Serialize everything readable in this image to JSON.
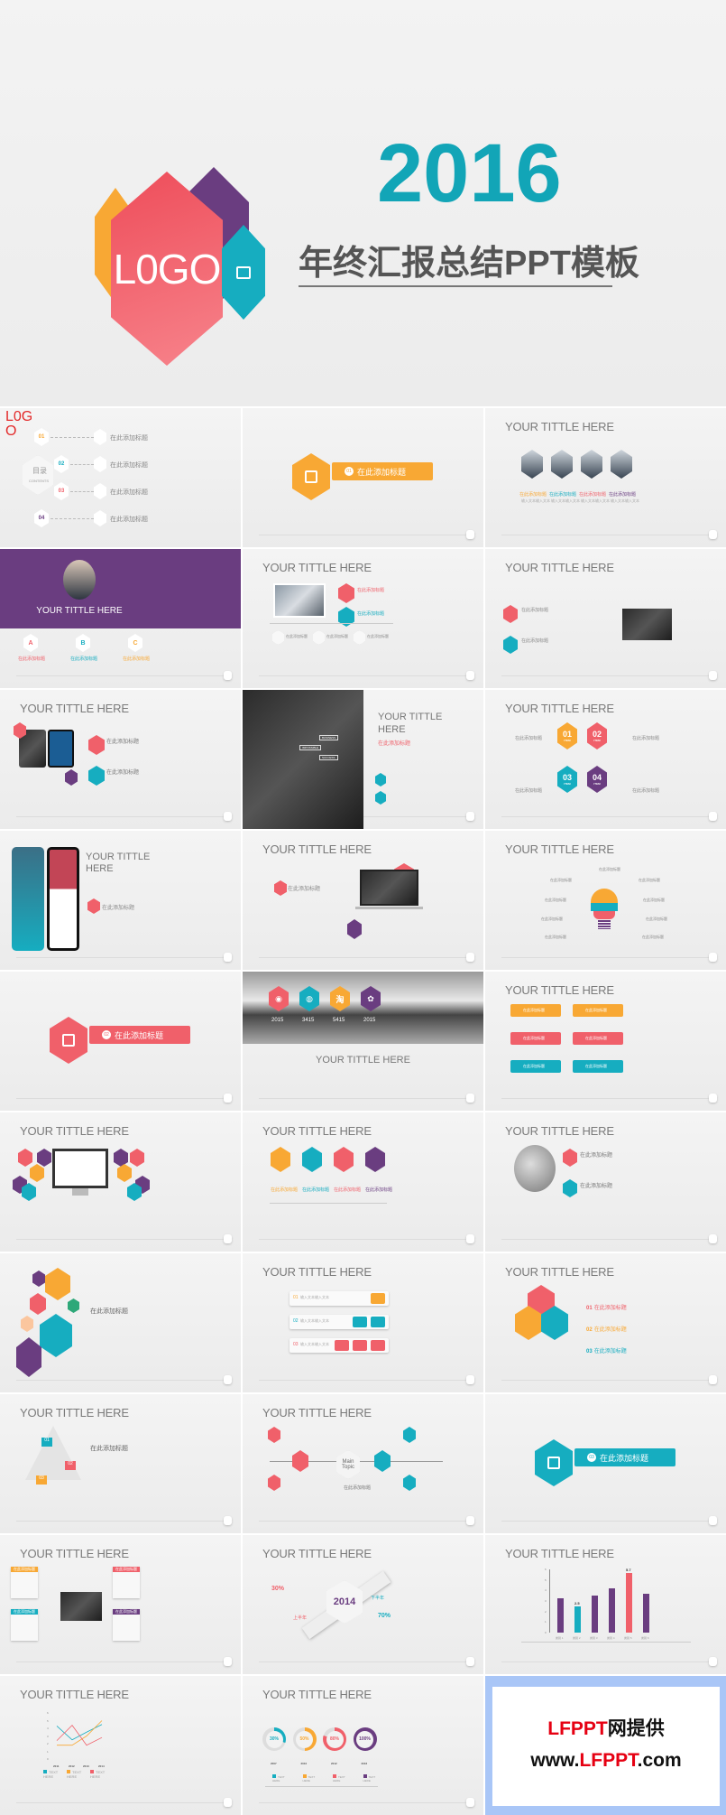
{
  "colors": {
    "red": "#f0606a",
    "orange": "#f8a834",
    "teal": "#16adc0",
    "purple": "#6a3d80",
    "gray": "#7a7a7a"
  },
  "hero": {
    "logo": "L0GO",
    "year": "2016",
    "subtitle": "年终汇报总结PPT模板",
    "icon": "chat-icon"
  },
  "common": {
    "title": "YOUR TITTLE HERE",
    "heading": "在此添加标题",
    "note": "输入文本输入文本",
    "text_here": "TEXT HERE"
  },
  "slides": [
    {
      "kind": "contents",
      "logo": "L0G\nO",
      "label": "目录",
      "label_en": "CONTENTS",
      "items": [
        {
          "num": "01",
          "text": "在此添加标题"
        },
        {
          "num": "02",
          "text": "在此添加标题"
        },
        {
          "num": "03",
          "text": "在此添加标题"
        },
        {
          "num": "04",
          "text": "在此添加标题"
        }
      ]
    },
    {
      "kind": "section",
      "num": "01",
      "text": "在此添加标题",
      "color": "orange"
    },
    {
      "kind": "team",
      "title": "YOUR TITTLE HERE",
      "items": [
        {
          "text": "在此添加标题",
          "color": "orange"
        },
        {
          "text": "在此添加标题",
          "color": "teal"
        },
        {
          "text": "在此添加标题",
          "color": "red"
        },
        {
          "text": "在此添加标题",
          "color": "purple"
        }
      ]
    },
    {
      "kind": "banner",
      "title": "YOUR TITTLE HERE",
      "items": [
        {
          "letter": "A",
          "text": "在此添加标题",
          "color": "red"
        },
        {
          "letter": "B",
          "text": "在此添加标题",
          "color": "teal"
        },
        {
          "letter": "C",
          "text": "在此添加标题",
          "color": "orange"
        }
      ]
    },
    {
      "kind": "photo2",
      "title": "YOUR TITTLE HERE",
      "items": [
        {
          "text": "在此添加标题",
          "color": "red"
        },
        {
          "text": "在此添加标题",
          "color": "teal"
        }
      ],
      "bottom": [
        "在此添加标题",
        "在此添加标题",
        "在此添加标题"
      ]
    },
    {
      "kind": "idea",
      "title": "YOUR TITTLE HERE",
      "items": [
        {
          "text": "在此添加标题",
          "color": "red"
        },
        {
          "text": "在此添加标题",
          "color": "teal"
        }
      ]
    },
    {
      "kind": "tablets",
      "title": "YOUR TITTLE HERE",
      "items": [
        {
          "text": "在此添加标题",
          "color": "red"
        },
        {
          "text": "在此添加标题",
          "color": "teal"
        }
      ]
    },
    {
      "kind": "darkside",
      "title": "YOUR TITTLE HERE",
      "heading": "在此添加标题",
      "signs": [
        "BUSINESS",
        "IMPOSSIBLE",
        "SUCCESS"
      ]
    },
    {
      "kind": "items4",
      "title": "YOUR TITTLE HERE",
      "items": [
        {
          "num": "01",
          "tag": "ITEM",
          "color": "orange"
        },
        {
          "num": "02",
          "tag": "ITEM",
          "color": "red"
        },
        {
          "num": "03",
          "tag": "ITEM",
          "color": "teal"
        },
        {
          "num": "04",
          "tag": "ITEM",
          "color": "purple"
        }
      ],
      "labels": [
        "在此添加标题",
        "在此添加标题",
        "在此添加标题",
        "在此添加标题"
      ]
    },
    {
      "kind": "phones",
      "title": "YOUR TITTLE HERE",
      "heading": "在此添加标题"
    },
    {
      "kind": "laptop",
      "title": "YOUR TITTLE HERE",
      "heading": "在此添加标题"
    },
    {
      "kind": "bulb",
      "title": "YOUR TITTLE HERE",
      "labels": [
        "在此添加标题",
        "在此添加标题",
        "在此添加标题",
        "在此添加标题",
        "在此添加标题",
        "在此添加标题",
        "在此添加标题",
        "在此添加标题",
        "在此添加标题"
      ]
    },
    {
      "kind": "section",
      "num": "02",
      "text": "在此添加标题",
      "color": "red"
    },
    {
      "kind": "bridge",
      "title": "YOUR TITTLE HERE",
      "items": [
        {
          "year": "2015",
          "icon": "weibo-icon",
          "glyph": "◉",
          "color": "red"
        },
        {
          "year": "3415",
          "icon": "wechat-icon",
          "glyph": "◍",
          "color": "teal"
        },
        {
          "year": "5415",
          "icon": "taobao-icon",
          "glyph": "淘",
          "color": "orange"
        },
        {
          "year": "2015",
          "icon": "paw-icon",
          "glyph": "✿",
          "color": "purple"
        }
      ]
    },
    {
      "kind": "six",
      "title": "YOUR TITTLE HERE",
      "items": [
        {
          "text": "在此添加标题",
          "color": "orange"
        },
        {
          "text": "在此添加标题",
          "color": "orange"
        },
        {
          "text": "在此添加标题",
          "color": "red"
        },
        {
          "text": "在此添加标题",
          "color": "red"
        },
        {
          "text": "在此添加标题",
          "color": "teal"
        },
        {
          "text": "在此添加标题",
          "color": "teal"
        }
      ]
    },
    {
      "kind": "monitor",
      "title": "YOUR TITTLE HERE"
    },
    {
      "kind": "hex4",
      "title": "YOUR TITTLE HERE",
      "items": [
        {
          "text": "在此添加标题",
          "color": "orange"
        },
        {
          "text": "在此添加标题",
          "color": "teal"
        },
        {
          "text": "在此添加标题",
          "color": "red"
        },
        {
          "text": "在此添加标题",
          "color": "purple"
        }
      ]
    },
    {
      "kind": "globe",
      "title": "YOUR TITTLE HERE",
      "items": [
        {
          "text": "在此添加标题",
          "color": "red"
        },
        {
          "text": "在此添加标题",
          "color": "teal"
        }
      ]
    },
    {
      "kind": "cluster",
      "heading": "在此添加标题"
    },
    {
      "kind": "rows3",
      "title": "YOUR TITTLE HERE",
      "nums": [
        "01",
        "02",
        "03"
      ]
    },
    {
      "kind": "tri3",
      "title": "YOUR TITTLE HERE",
      "items": [
        {
          "num": "01",
          "text": "在此添加标题",
          "color": "red"
        },
        {
          "num": "02",
          "text": "在此添加标题",
          "color": "orange"
        },
        {
          "num": "03",
          "text": "在此添加标题",
          "color": "teal"
        }
      ]
    },
    {
      "kind": "triangle",
      "title": "YOUR TITTLE HERE",
      "heading": "在此添加标题",
      "nums": [
        "01",
        "02",
        "03"
      ]
    },
    {
      "kind": "topic",
      "title": "YOUR TITTLE HERE",
      "center": "Main Topic",
      "heading": "在此添加标题"
    },
    {
      "kind": "section",
      "num": "03",
      "text": "在此添加标题",
      "color": "teal"
    },
    {
      "kind": "cards",
      "title": "YOUR TITTLE HERE",
      "items": [
        {
          "text": "在此添加标题",
          "color": "orange"
        },
        {
          "text": "在此添加标题",
          "color": "red"
        },
        {
          "text": "在此添加标题",
          "color": "teal"
        },
        {
          "text": "在此添加标题",
          "color": "purple"
        }
      ]
    },
    {
      "kind": "year",
      "title": "YOUR TITTLE HERE",
      "year": "2014",
      "heading": "在此添加标题",
      "left_pct": "30%",
      "right_pct": "70%",
      "first_half": "上半年",
      "second_half": "下半年"
    },
    {
      "kind": "barchart",
      "title": "YOUR TITTLE HERE"
    },
    {
      "kind": "linechart",
      "title": "YOUR TITTLE HERE"
    },
    {
      "kind": "donuts",
      "title": "YOUR TITTLE HERE"
    },
    {
      "kind": "ad",
      "line1_a": "LFPPT",
      "line1_b": "网提供",
      "line2_a": "www.",
      "line2_b": "LFPPT",
      ".line2_c": "",
      "line2_c": ".com"
    }
  ],
  "chart_data": [
    {
      "type": "bar",
      "categories": [
        "类别 1",
        "类别 2",
        "类别 3",
        "类别 4",
        "类别 5",
        "类别 6"
      ],
      "values": [
        3.3,
        2.5,
        3.5,
        4.2,
        5.7,
        3.7
      ],
      "colors": [
        "purple",
        "teal",
        "purple",
        "purple",
        "red",
        "purple"
      ],
      "data_labels": [
        "",
        "2.5",
        "",
        "",
        "5.7",
        ""
      ],
      "ylim": [
        0,
        6
      ],
      "yticks": [
        0,
        1,
        2,
        3,
        4,
        5,
        6
      ]
    },
    {
      "type": "line",
      "x": [
        "2011",
        "2012",
        "2013",
        "2014"
      ],
      "ylim": [
        0,
        6
      ],
      "yticks": [
        0,
        1,
        2,
        3,
        4,
        5,
        6
      ],
      "series": [
        {
          "name": "TEXT HERE",
          "color": "teal",
          "values": [
            4.3,
            2.5,
            3.5,
            4.5
          ]
        },
        {
          "name": "TEXT HERE",
          "color": "orange",
          "values": [
            1.8,
            1.8,
            3.0,
            5.0
          ]
        },
        {
          "name": "TEXT HERE",
          "color": "red",
          "values": [
            2.4,
            4.4,
            1.8,
            2.8
          ]
        }
      ]
    },
    {
      "type": "pie",
      "items": [
        {
          "label": "30%",
          "value": 30,
          "year": "2007",
          "color": "teal"
        },
        {
          "label": "50%",
          "value": 50,
          "year": "2010",
          "color": "orange"
        },
        {
          "label": "80%",
          "value": 80,
          "year": "2012",
          "color": "red"
        },
        {
          "label": "100%",
          "value": 100,
          "year": "2016",
          "color": "purple"
        }
      ],
      "legend": [
        "TEXT HERE",
        "TEXT HERE",
        "TEXT HERE",
        "TEXT HERE"
      ]
    }
  ]
}
